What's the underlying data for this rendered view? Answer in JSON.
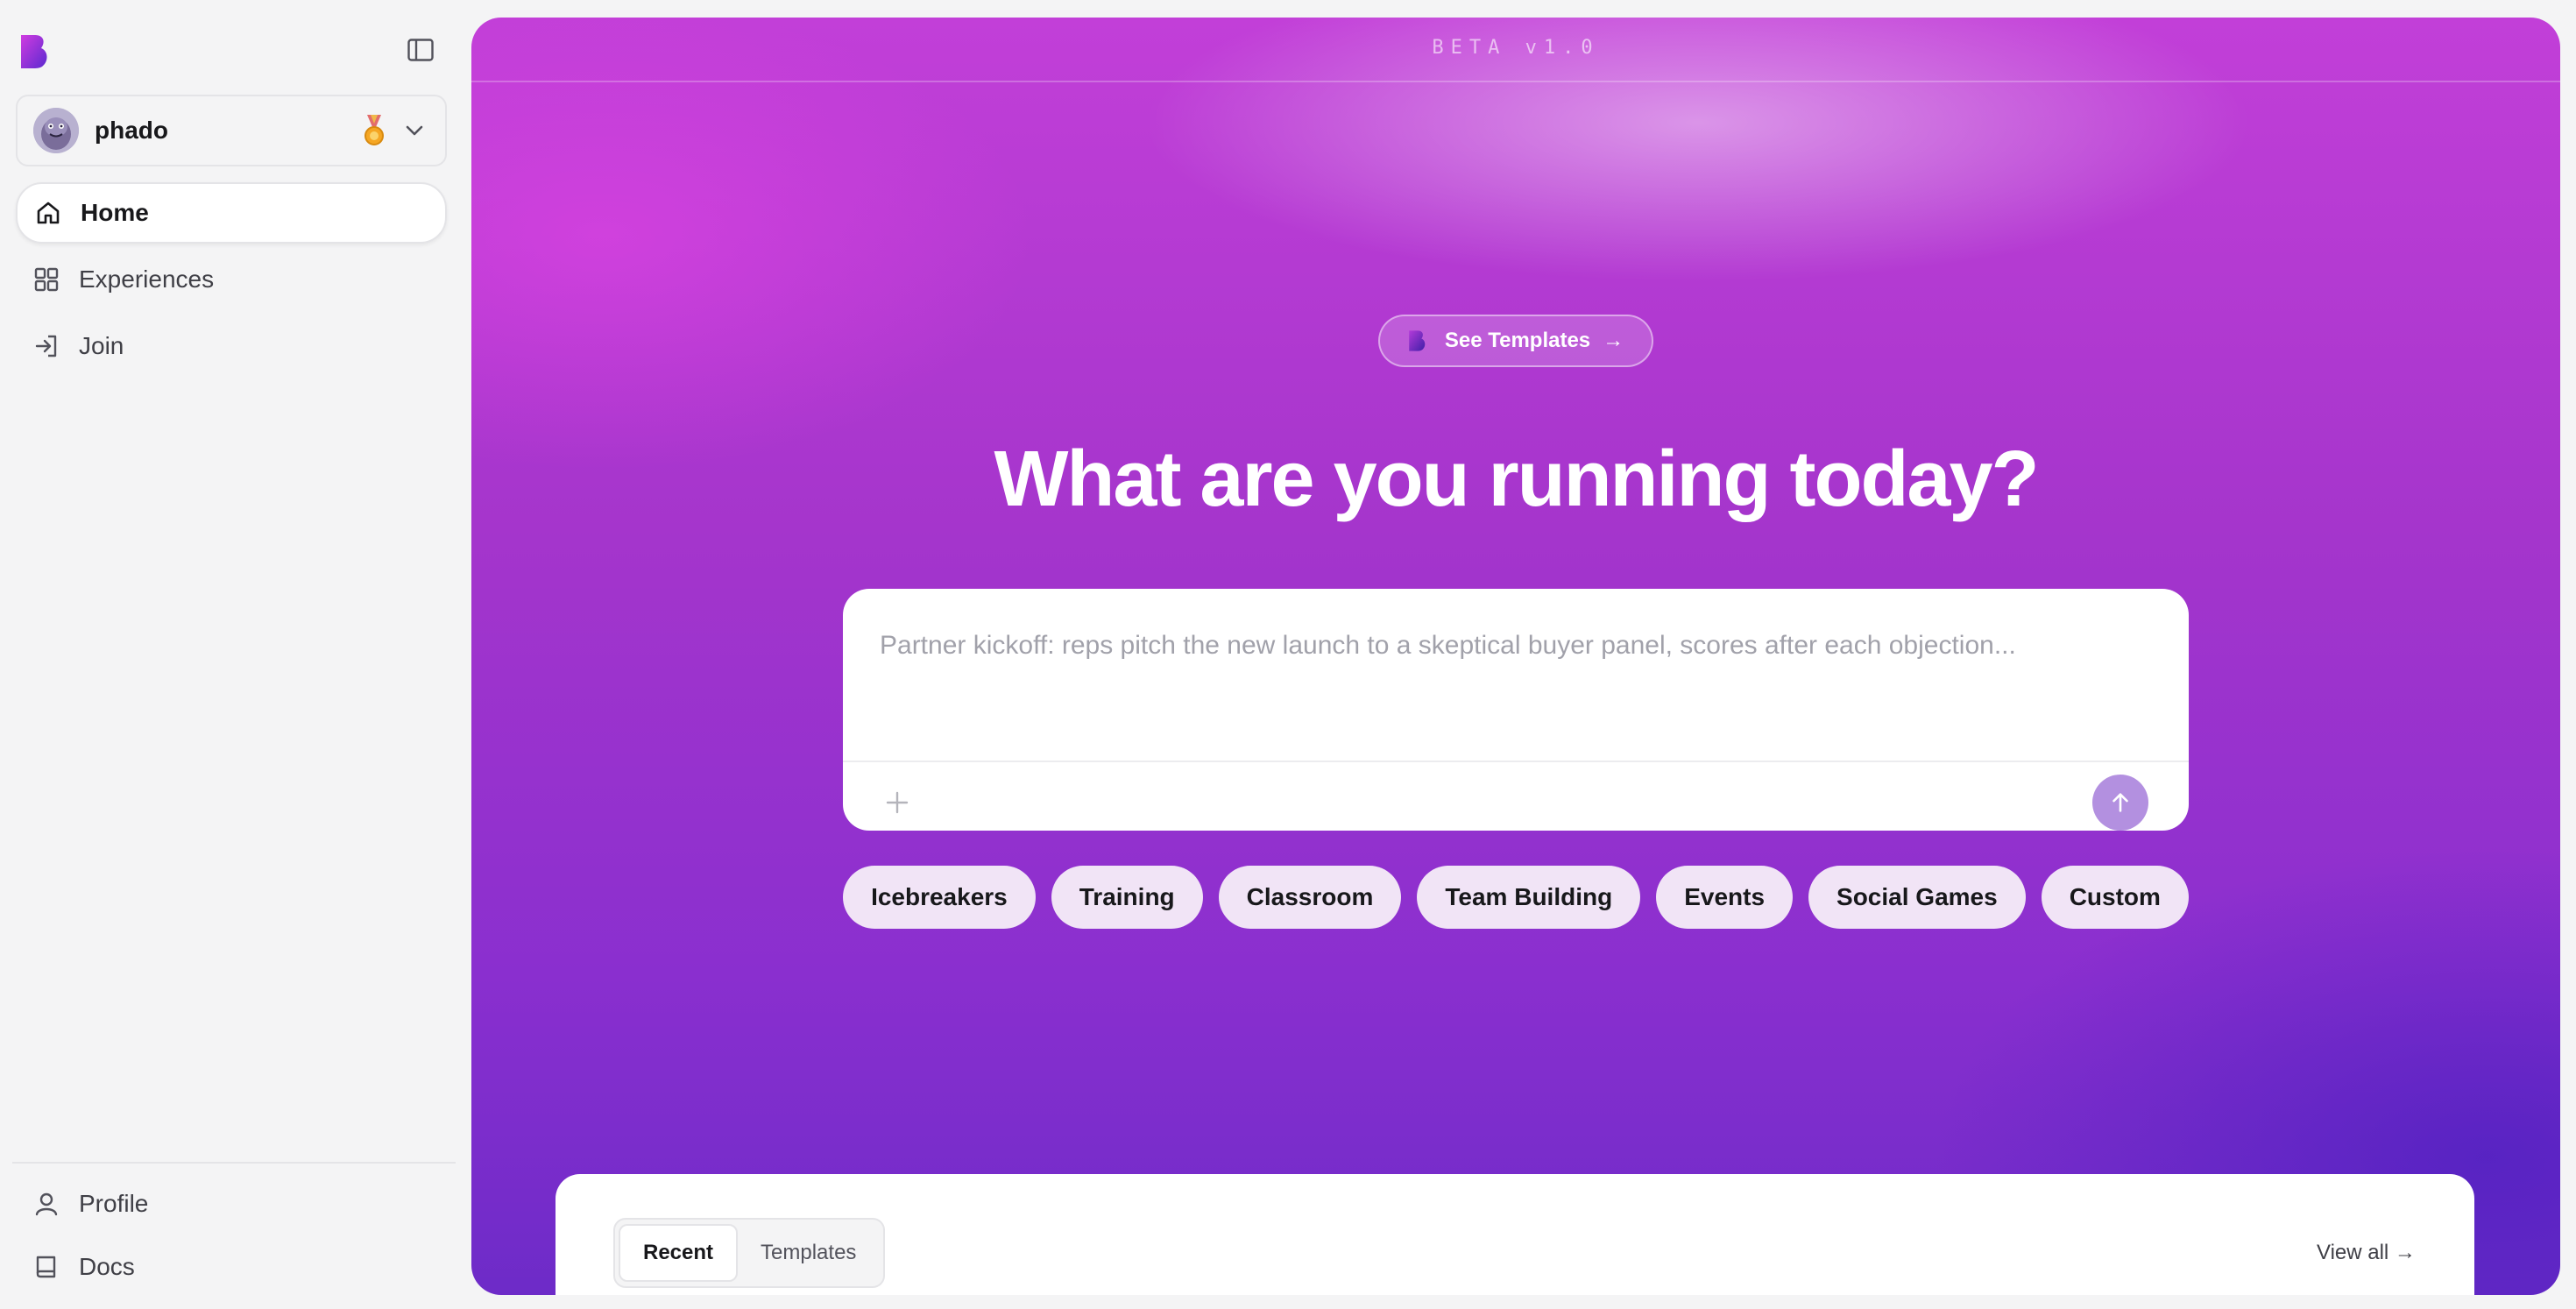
{
  "sidebar": {
    "account": {
      "name": "phado"
    },
    "nav": [
      {
        "label": "Home",
        "icon": "home-icon",
        "active": true
      },
      {
        "label": "Experiences",
        "icon": "grid-icon",
        "active": false
      },
      {
        "label": "Join",
        "icon": "sign-in-icon",
        "active": false
      }
    ],
    "bottom_nav": [
      {
        "label": "Profile",
        "icon": "user-icon"
      },
      {
        "label": "Docs",
        "icon": "book-icon"
      }
    ]
  },
  "main": {
    "beta_label": "BETA v1.0",
    "see_templates": {
      "label": "See Templates",
      "arrow": "→"
    },
    "hero_title": "What are you running today?",
    "prompt": {
      "placeholder": "Partner kickoff: reps pitch the new launch to a skeptical buyer panel, scores after each objection..."
    },
    "chips": [
      "Icebreakers",
      "Training",
      "Classroom",
      "Team Building",
      "Events",
      "Social Games",
      "Custom"
    ],
    "recent": {
      "tabs": [
        "Recent",
        "Templates"
      ],
      "active_tab": "Recent",
      "view_all": "View all →"
    }
  },
  "colors": {
    "accent": "#9b35cf",
    "send_button": "#b390e0",
    "chip_bg": "#f1e4f6"
  }
}
